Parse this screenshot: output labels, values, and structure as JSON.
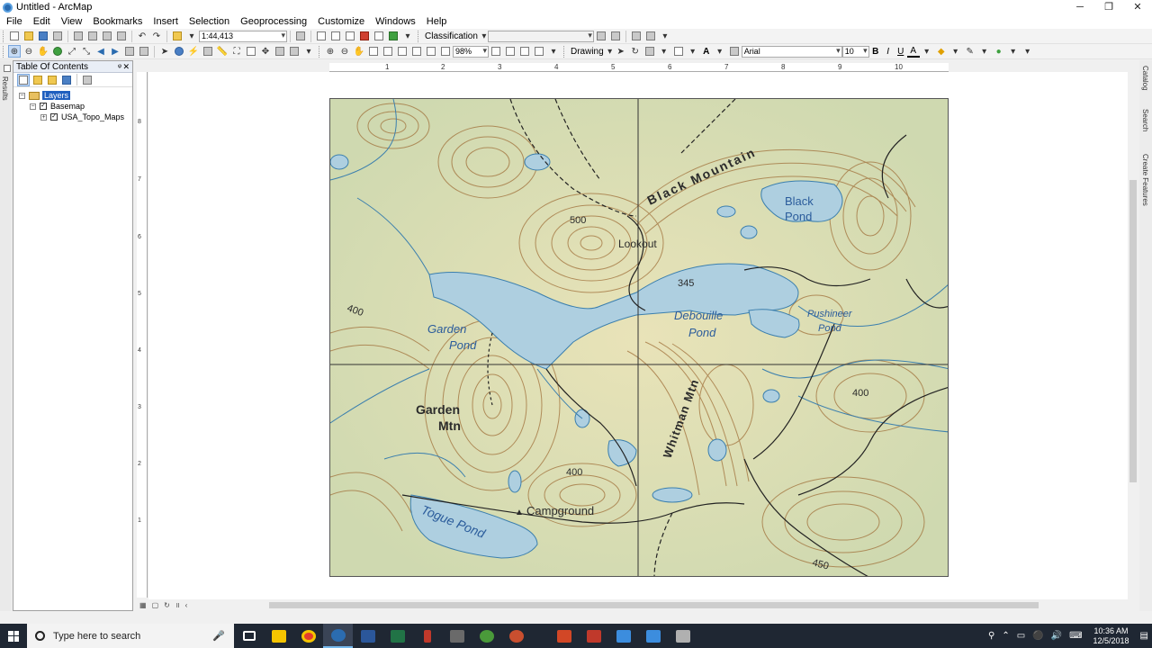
{
  "window": {
    "title": "Untitled - ArcMap",
    "minimize": "─",
    "maximize": "❐",
    "close": "✕"
  },
  "menu": [
    "File",
    "Edit",
    "View",
    "Bookmarks",
    "Insert",
    "Selection",
    "Geoprocessing",
    "Customize",
    "Windows",
    "Help"
  ],
  "toolbar1": {
    "scale": "1:44,413",
    "classification_label": "Classification",
    "classification_value": ""
  },
  "toolbar2": {
    "zoom_percent": "98%",
    "drawing_label": "Drawing",
    "font_name": "Arial",
    "font_size": "10",
    "bold": "B",
    "italic": "I",
    "underline": "U",
    "text_a": "A"
  },
  "toc": {
    "title": "Table Of Contents",
    "pin": "ᵠ",
    "close": "✕",
    "layers_label": "Layers",
    "basemap_label": "Basemap",
    "topo_label": "USA_Topo_Maps",
    "expand_minus": "−",
    "expand_plus": "+",
    "check": "✓"
  },
  "left_strip": {
    "results_tab": "Results"
  },
  "right_bar": {
    "catalog_tab": "Catalog",
    "search_tab": "Search",
    "create_features_tab": "Create Features"
  },
  "rulers": {
    "h_numbers": [
      "1",
      "2",
      "3",
      "4",
      "5",
      "6",
      "7",
      "8",
      "9",
      "10"
    ],
    "v_numbers": [
      "8",
      "7",
      "6",
      "5",
      "4",
      "3",
      "2",
      "1"
    ]
  },
  "map_labels": {
    "black_mountain": "Black Mountain",
    "black_pond": "Black\nPond",
    "lookout": "Lookout",
    "elev_500": "500",
    "elev_345": "345",
    "elev_400_left": "400",
    "garden_pond": "Garden\nPond",
    "debouille_pond": "Debouille\nPond",
    "pushineer_pond": "Pushineer\nPond",
    "whitman_mtn": "Whitman Mtn",
    "garden_mtn": "Garden\nMtn",
    "elev_400_right": "400",
    "elev_400_bottom": "400",
    "campground": "Campground",
    "togue_pond": "Togue Pond",
    "elev_450": "450"
  },
  "view_buttons": [
    "▦",
    "▢",
    "↻",
    "॥",
    "‹"
  ],
  "taskbar": {
    "search_placeholder": "Type here to search",
    "mic": "🎤",
    "time": "10:36 AM",
    "date": "12/5/2018",
    "tray_icons": [
      "⚲",
      "⌃",
      "▭",
      "⚫",
      "🔊",
      "⌨"
    ],
    "app_colors": [
      "#ffffff",
      "#f5c400",
      "#e53c2c",
      "#2b6cb0",
      "#2b579a",
      "#217346",
      "#c0392b",
      "#6a6a6a",
      "#4a9a3a",
      "#c94f2f",
      "#d24726",
      "#c0392b",
      "#3c8dde",
      "#3c8dde",
      "#b0b0b0"
    ]
  }
}
